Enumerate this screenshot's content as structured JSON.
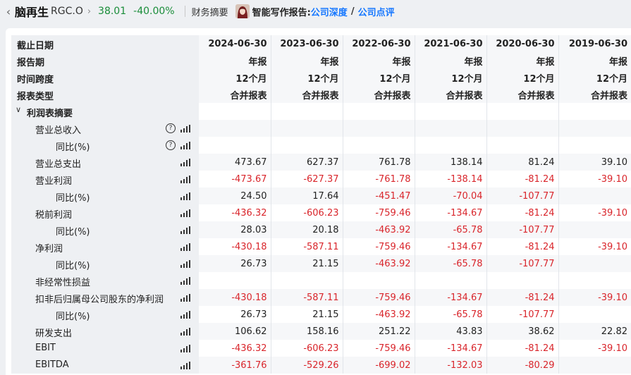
{
  "topbar": {
    "back_icon": "chevron-left-icon",
    "stock_name": "脑再生",
    "stock_code": "RGC.O",
    "chevron": "›",
    "price": "38.01",
    "change_pct": "-40.00%",
    "financial_summary": "财务摘要",
    "ai_report_label": "智能写作报告:",
    "link_depth": "公司深度",
    "separator": "/",
    "link_review": "公司点评",
    "colors": {
      "change": "#1a8d3a",
      "link": "#1677ff",
      "negative": "#d9252b"
    }
  },
  "header_rows": [
    {
      "label": "截止日期",
      "values": [
        "2024-06-30",
        "2023-06-30",
        "2022-06-30",
        "2021-06-30",
        "2020-06-30",
        "2019-06-30"
      ]
    },
    {
      "label": "报告期",
      "values": [
        "年报",
        "年报",
        "年报",
        "年报",
        "年报",
        "年报"
      ]
    },
    {
      "label": "时间跨度",
      "values": [
        "12个月",
        "12个月",
        "12个月",
        "12个月",
        "12个月",
        "12个月"
      ]
    },
    {
      "label": "报表类型",
      "values": [
        "合并报表",
        "合并报表",
        "合并报表",
        "合并报表",
        "合并报表",
        "合并报表"
      ]
    }
  ],
  "section": {
    "label": "利润表摘要",
    "expanded": true,
    "caret_icon": "chevron-down-icon"
  },
  "rows": [
    {
      "label": "营业总收入",
      "indent": 1,
      "help": true,
      "values": [
        "",
        "",
        "",
        "",
        "",
        ""
      ]
    },
    {
      "label": "同比(%)",
      "indent": 2,
      "help": true,
      "values": [
        "",
        "",
        "",
        "",
        "",
        ""
      ]
    },
    {
      "label": "营业总支出",
      "indent": 1,
      "values": [
        "473.67",
        "627.37",
        "761.78",
        "138.14",
        "81.24",
        "39.10"
      ]
    },
    {
      "label": "营业利润",
      "indent": 1,
      "values": [
        "-473.67",
        "-627.37",
        "-761.78",
        "-138.14",
        "-81.24",
        "-39.10"
      ]
    },
    {
      "label": "同比(%)",
      "indent": 2,
      "values": [
        "24.50",
        "17.64",
        "-451.47",
        "-70.04",
        "-107.77",
        ""
      ]
    },
    {
      "label": "税前利润",
      "indent": 1,
      "values": [
        "-436.32",
        "-606.23",
        "-759.46",
        "-134.67",
        "-81.24",
        "-39.10"
      ]
    },
    {
      "label": "同比(%)",
      "indent": 2,
      "values": [
        "28.03",
        "20.18",
        "-463.92",
        "-65.78",
        "-107.77",
        ""
      ]
    },
    {
      "label": "净利润",
      "indent": 1,
      "values": [
        "-430.18",
        "-587.11",
        "-759.46",
        "-134.67",
        "-81.24",
        "-39.10"
      ]
    },
    {
      "label": "同比(%)",
      "indent": 2,
      "values": [
        "26.73",
        "21.15",
        "-463.92",
        "-65.78",
        "-107.77",
        ""
      ]
    },
    {
      "label": "非经常性损益",
      "indent": 1,
      "values": [
        "",
        "",
        "",
        "",
        "",
        ""
      ]
    },
    {
      "label": "扣非后归属母公司股东的净利润",
      "indent": 1,
      "values": [
        "-430.18",
        "-587.11",
        "-759.46",
        "-134.67",
        "-81.24",
        "-39.10"
      ]
    },
    {
      "label": "同比(%)",
      "indent": 2,
      "values": [
        "26.73",
        "21.15",
        "-463.92",
        "-65.78",
        "-107.77",
        ""
      ]
    },
    {
      "label": "研发支出",
      "indent": 1,
      "values": [
        "106.62",
        "158.16",
        "251.22",
        "43.83",
        "38.62",
        "22.82"
      ]
    },
    {
      "label": "EBIT",
      "indent": 1,
      "values": [
        "-436.32",
        "-606.23",
        "-759.46",
        "-134.67",
        "-81.24",
        "-39.10"
      ]
    },
    {
      "label": "EBITDA",
      "indent": 1,
      "values": [
        "-361.76",
        "-529.26",
        "-699.02",
        "-132.03",
        "-80.29",
        ""
      ]
    }
  ],
  "icons": {
    "help": "question-circle-icon",
    "chart": "bar-chart-icon"
  }
}
